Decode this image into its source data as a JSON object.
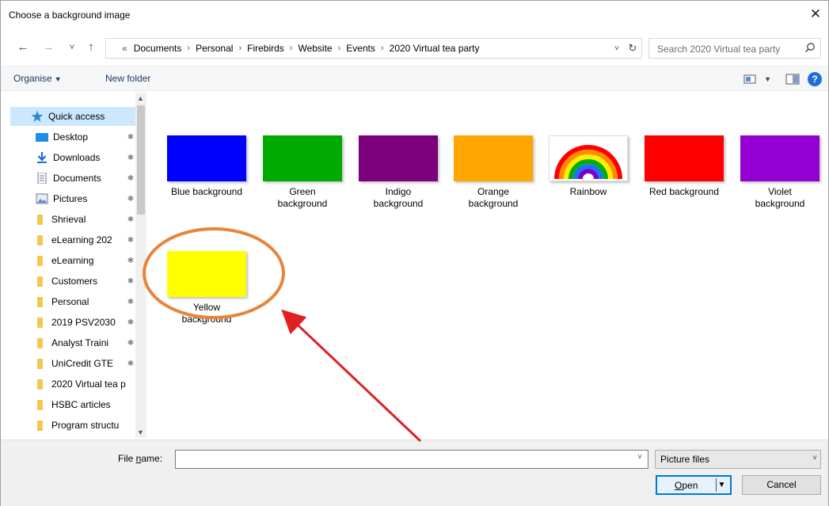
{
  "window": {
    "title": "Choose a background image",
    "close_glyph": "✕"
  },
  "nav": {
    "back_glyph": "←",
    "forward_glyph": "→",
    "recent_glyph": "˅",
    "up_glyph": "↑",
    "lead_glyph": "«",
    "breadcrumbs": [
      "Documents",
      "Personal",
      "Firebirds",
      "Website",
      "Events",
      "2020 Virtual tea party"
    ],
    "sep_glyph": "›",
    "dropdown_glyph": "˅",
    "refresh_glyph": "↻"
  },
  "search": {
    "placeholder": "Search 2020 Virtual tea party"
  },
  "toolbar": {
    "organise_label": "Organise",
    "organise_caret": "▼",
    "new_folder_label": "New folder",
    "view_caret": "▼",
    "help_glyph": "?"
  },
  "sidebar": {
    "items": [
      {
        "label": "Quick access",
        "icon": "star-icon",
        "pinned": false
      },
      {
        "label": "Desktop",
        "icon": "desktop-icon",
        "pinned": true
      },
      {
        "label": "Downloads",
        "icon": "download-icon",
        "pinned": true
      },
      {
        "label": "Documents",
        "icon": "documents-icon",
        "pinned": true
      },
      {
        "label": "Pictures",
        "icon": "pictures-icon",
        "pinned": true
      },
      {
        "label": "Shrieval",
        "icon": "folder-icon",
        "pinned": true
      },
      {
        "label": "eLearning 202",
        "icon": "folder-icon",
        "pinned": true
      },
      {
        "label": "eLearning",
        "icon": "folder-icon",
        "pinned": true
      },
      {
        "label": "Customers",
        "icon": "folder-icon",
        "pinned": true
      },
      {
        "label": "Personal",
        "icon": "folder-icon",
        "pinned": true
      },
      {
        "label": "2019 PSV2030",
        "icon": "folder-icon",
        "pinned": true
      },
      {
        "label": "Analyst Traini",
        "icon": "folder-icon",
        "pinned": true
      },
      {
        "label": "UniCredit GTE",
        "icon": "folder-icon",
        "pinned": true
      },
      {
        "label": "2020 Virtual tea p",
        "icon": "folder-icon",
        "pinned": false
      },
      {
        "label": "HSBC articles",
        "icon": "folder-icon",
        "pinned": false
      },
      {
        "label": "Program structu",
        "icon": "folder-icon",
        "pinned": false
      }
    ],
    "pin_glyph": "✱",
    "scroll_up_glyph": "▲",
    "scroll_down_glyph": "▼"
  },
  "files": [
    {
      "name": "Blue background",
      "color": "#0000ff"
    },
    {
      "name": "Green background",
      "color": "#00aa00"
    },
    {
      "name": "Indigo background",
      "color": "#7c007c"
    },
    {
      "name": "Orange background",
      "color": "#ffa500"
    },
    {
      "name": "Rainbow",
      "color": "rainbow"
    },
    {
      "name": "Red background",
      "color": "#ff0000"
    },
    {
      "name": "Violet background",
      "color": "#9400d3"
    },
    {
      "name": "Yellow background",
      "color": "#ffff00"
    }
  ],
  "annotation": {
    "ellipse_color": "#e8843c",
    "arrow_color": "#e02020"
  },
  "footer": {
    "file_name_label_pre": "File ",
    "file_name_label_underline": "n",
    "file_name_label_post": "ame:",
    "file_name_value": "",
    "file_name_dropdown_glyph": "˅",
    "file_type_value": "Picture files",
    "file_type_dropdown_glyph": "˅",
    "open_label_underline": "O",
    "open_label_rest": "pen",
    "open_split_glyph": "▼",
    "cancel_label": "Cancel"
  }
}
